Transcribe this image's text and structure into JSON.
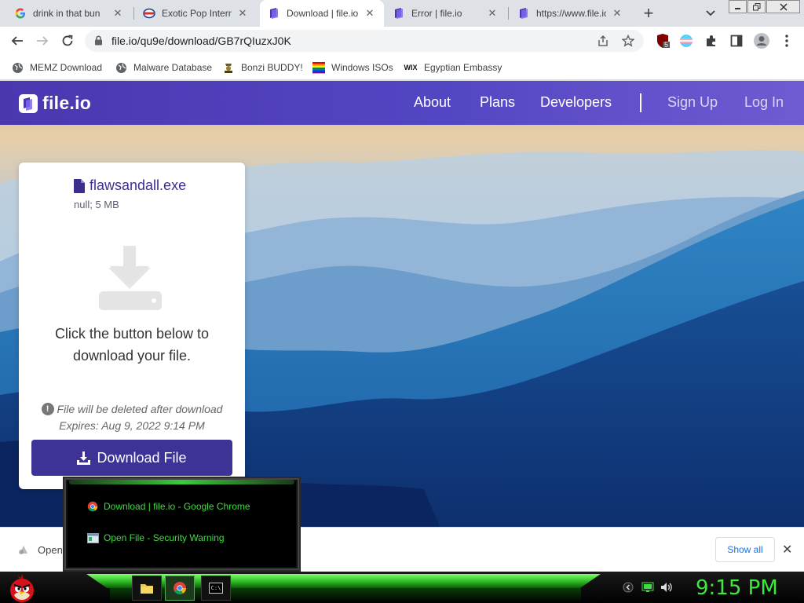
{
  "browser": {
    "tabs": [
      {
        "title": "drink in that bun",
        "icon": "google-icon",
        "active": false
      },
      {
        "title": "Exotic Pop Interna",
        "icon": "exotic-pop-icon",
        "active": false
      },
      {
        "title": "Download | file.io",
        "icon": "fileio-icon",
        "active": true
      },
      {
        "title": "Error | file.io",
        "icon": "fileio-icon",
        "active": false
      },
      {
        "title": "https://www.file.io",
        "icon": "fileio-icon",
        "active": false
      }
    ],
    "url": "file.io/qu9e/download/GB7rQIuzxJ0K",
    "extension_badge": "5",
    "bookmarks": [
      {
        "label": "MEMZ Download",
        "icon": "globe-icon"
      },
      {
        "label": "Malware Database",
        "icon": "globe-icon"
      },
      {
        "label": "Bonzi BUDDY!",
        "icon": "bonzi-icon"
      },
      {
        "label": "Windows ISOs",
        "icon": "rainbow-icon"
      },
      {
        "label": "Egyptian Embassy",
        "icon": "wix-icon"
      }
    ],
    "wix_text": "WIX"
  },
  "site": {
    "logo_text": "file.io",
    "nav": {
      "about": "About",
      "plans": "Plans",
      "developers": "Developers",
      "sign_up": "Sign Up",
      "log_in": "Log In"
    },
    "card": {
      "filename": "flawsandall.exe",
      "meta": "null; 5 MB",
      "message": "Click the button below to download your file.",
      "delete_note": "File will be deleted after download",
      "info_glyph": "!",
      "expires": "Expires: Aug 9, 2022 9:14 PM",
      "download_label": "Download File"
    },
    "colors": {
      "nav_purple": "#5346c2",
      "button_purple": "#3d3296"
    }
  },
  "download_bar": {
    "item_label": "Open",
    "show_all": "Show all",
    "close": "✕"
  },
  "taskbar": {
    "popup_items": [
      {
        "label": "Download | file.io - Google Chrome",
        "icon": "chrome-icon"
      },
      {
        "label": "Open File - Security Warning",
        "icon": "window-icon"
      }
    ],
    "cmd_text": "C:\\",
    "clock": "9:15 PM"
  }
}
